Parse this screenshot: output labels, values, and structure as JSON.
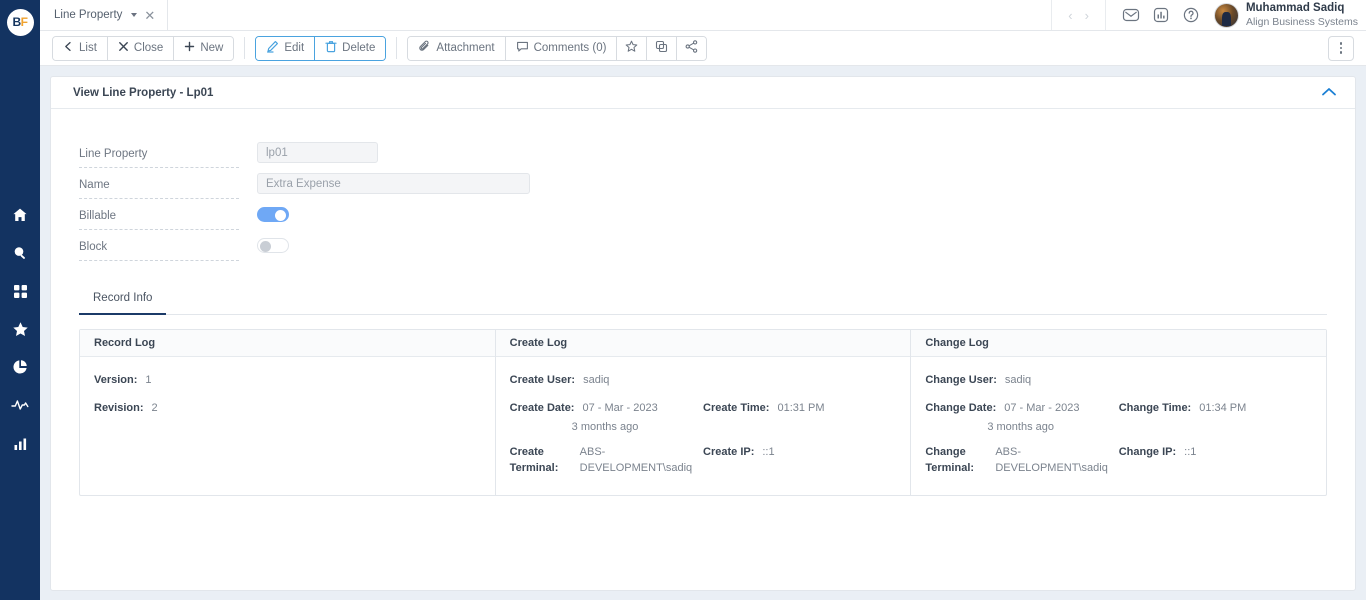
{
  "app": {
    "logo_b": "B",
    "logo_f": "F"
  },
  "sidebar": {
    "items": [
      {
        "name": "home",
        "label": "Home"
      },
      {
        "name": "search",
        "label": "Search"
      },
      {
        "name": "apps",
        "label": "Apps"
      },
      {
        "name": "favorites",
        "label": "Favorites"
      },
      {
        "name": "reports",
        "label": "Reports"
      },
      {
        "name": "activity",
        "label": "Activity"
      },
      {
        "name": "analytics",
        "label": "Analytics"
      }
    ]
  },
  "topbar": {
    "tab_label": "Line Property",
    "tab_close": "✕",
    "nav_prev": "‹",
    "nav_next": "›",
    "user_name": "Muhammad Sadiq",
    "user_org": "Align Business Systems"
  },
  "toolbar": {
    "list_label": "List",
    "close_label": "Close",
    "new_label": "New",
    "edit_label": "Edit",
    "delete_label": "Delete",
    "attachment_label": "Attachment",
    "comments_label": "Comments (0)"
  },
  "card": {
    "title": "View Line Property - Lp01"
  },
  "form": {
    "fields": [
      {
        "label": "Line Property",
        "value": "lp01",
        "type": "text"
      },
      {
        "label": "Name",
        "value": "Extra Expense",
        "type": "text"
      },
      {
        "label": "Billable",
        "value": "on",
        "type": "toggle"
      },
      {
        "label": "Block",
        "value": "off",
        "type": "toggle"
      }
    ]
  },
  "record_tab": {
    "label": "Record Info"
  },
  "logs": {
    "record": {
      "header": "Record Log",
      "version_label": "Version:",
      "version_value": "1",
      "revision_label": "Revision:",
      "revision_value": "2"
    },
    "create": {
      "header": "Create Log",
      "user_label": "Create User:",
      "user_value": "sadiq",
      "date_label": "Create Date:",
      "date_value": "07 - Mar - 2023",
      "date_relative": "3 months ago",
      "time_label": "Create Time:",
      "time_value": "01:31 PM",
      "terminal_label": "Create Terminal:",
      "terminal_value": "ABS-DEVELOPMENT\\sadiq",
      "ip_label": "Create IP:",
      "ip_value": "::1"
    },
    "change": {
      "header": "Change Log",
      "user_label": "Change User:",
      "user_value": "sadiq",
      "date_label": "Change Date:",
      "date_value": "07 - Mar - 2023",
      "date_relative": "3 months ago",
      "time_label": "Change Time:",
      "time_value": "01:34 PM",
      "terminal_label": "Change Terminal:",
      "terminal_value": "ABS-DEVELOPMENT\\sadiq",
      "ip_label": "Change IP:",
      "ip_value": "::1"
    }
  },
  "colors": {
    "sidebar": "#133361",
    "accent_blue": "#4aa3df",
    "toggle_on": "#6fa8f5",
    "page_bg": "#eaeff5",
    "tab_underline": "#1b3a68"
  }
}
